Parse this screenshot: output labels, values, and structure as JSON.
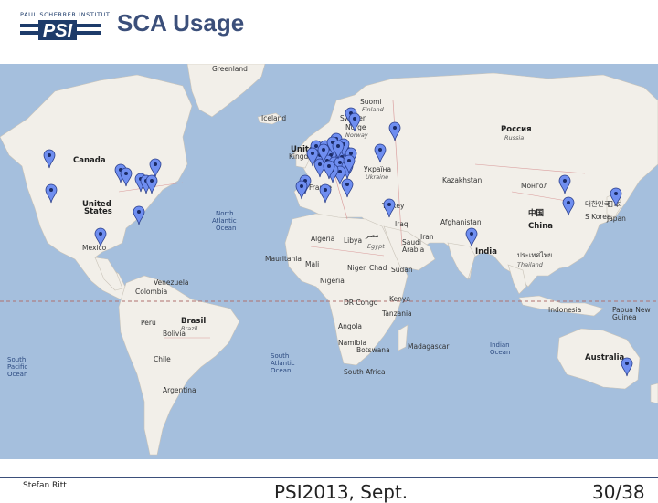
{
  "slide": {
    "title": "SCA Usage",
    "logo_text": "PAUL SCHERRER INSTITUT",
    "logo_mark": "PSI",
    "author": "Stefan Ritt",
    "conference": "PSI2013, Sept.",
    "page": "30/38"
  },
  "colors": {
    "title": "#3b4f7a",
    "ocean": "#a5bfdd",
    "land": "#f2efe9",
    "marker": "#6f8ef0",
    "rule": "#6f84a6"
  },
  "map": {
    "labels": [
      {
        "text": "Greenland",
        "cls": "ml"
      },
      {
        "text": "Iceland",
        "cls": "ml"
      },
      {
        "text": "Sweden",
        "cls": "ml"
      },
      {
        "text": "Suomi",
        "cls": "ml"
      },
      {
        "text": "Finland",
        "cls": "mls"
      },
      {
        "text": "Norge",
        "cls": "ml"
      },
      {
        "text": "Norway",
        "cls": "mls"
      },
      {
        "text": "Россия",
        "cls": "mlb"
      },
      {
        "text": "Russia",
        "cls": "mls"
      },
      {
        "text": "Canada",
        "cls": "mlb"
      },
      {
        "text": "United",
        "cls": "mlb"
      },
      {
        "text": "Kingdom",
        "cls": "ml"
      },
      {
        "text": "France",
        "cls": "ml"
      },
      {
        "text": "Україна",
        "cls": "ml"
      },
      {
        "text": "Ukraine",
        "cls": "mls"
      },
      {
        "text": "Kazakhstan",
        "cls": "ml"
      },
      {
        "text": "Монгол",
        "cls": "ml"
      },
      {
        "text": "United",
        "cls": "mlb"
      },
      {
        "text": "States",
        "cls": "mlb"
      },
      {
        "text": "North",
        "cls": "ocean"
      },
      {
        "text": "Atlantic",
        "cls": "ocean"
      },
      {
        "text": "Ocean",
        "cls": "ocean"
      },
      {
        "text": "Turkey",
        "cls": "ml"
      },
      {
        "text": "Iraq",
        "cls": "ml"
      },
      {
        "text": "Afghanistan",
        "cls": "ml"
      },
      {
        "text": "Iran",
        "cls": "ml"
      },
      {
        "text": "中国",
        "cls": "mlb"
      },
      {
        "text": "China",
        "cls": "mlb"
      },
      {
        "text": "대한민국",
        "cls": "ml"
      },
      {
        "text": "S Korea",
        "cls": "ml"
      },
      {
        "text": "日本",
        "cls": "ml"
      },
      {
        "text": "Japan",
        "cls": "ml"
      },
      {
        "text": "Mexico",
        "cls": "ml"
      },
      {
        "text": "Algeria",
        "cls": "ml"
      },
      {
        "text": "Libya",
        "cls": "ml"
      },
      {
        "text": "مصر",
        "cls": "ml"
      },
      {
        "text": "Egypt",
        "cls": "mls"
      },
      {
        "text": "Saudi",
        "cls": "ml"
      },
      {
        "text": "Arabia",
        "cls": "ml"
      },
      {
        "text": "India",
        "cls": "mlb"
      },
      {
        "text": "ประเทศไทย",
        "cls": "ml"
      },
      {
        "text": "Thailand",
        "cls": "mls"
      },
      {
        "text": "Mauritania",
        "cls": "ml"
      },
      {
        "text": "Mali",
        "cls": "ml"
      },
      {
        "text": "Niger",
        "cls": "ml"
      },
      {
        "text": "Chad",
        "cls": "ml"
      },
      {
        "text": "Sudan",
        "cls": "ml"
      },
      {
        "text": "Nigeria",
        "cls": "ml"
      },
      {
        "text": "Venezuela",
        "cls": "ml"
      },
      {
        "text": "Colombia",
        "cls": "ml"
      },
      {
        "text": "DR Congo",
        "cls": "ml"
      },
      {
        "text": "Kenya",
        "cls": "ml"
      },
      {
        "text": "Tanzania",
        "cls": "ml"
      },
      {
        "text": "Indonesia",
        "cls": "ml"
      },
      {
        "text": "Papua New",
        "cls": "ml"
      },
      {
        "text": "Guinea",
        "cls": "ml"
      },
      {
        "text": "Brasil",
        "cls": "mlb"
      },
      {
        "text": "Brazil",
        "cls": "mls"
      },
      {
        "text": "Peru",
        "cls": "ml"
      },
      {
        "text": "Bolivia",
        "cls": "ml"
      },
      {
        "text": "Angola",
        "cls": "ml"
      },
      {
        "text": "Namibia",
        "cls": "ml"
      },
      {
        "text": "Botswana",
        "cls": "ml"
      },
      {
        "text": "Madagascar",
        "cls": "ml"
      },
      {
        "text": "South Africa",
        "cls": "ml"
      },
      {
        "text": "Indian",
        "cls": "ocean"
      },
      {
        "text": "Ocean",
        "cls": "ocean"
      },
      {
        "text": "Australia",
        "cls": "mlb"
      },
      {
        "text": "South",
        "cls": "ocean"
      },
      {
        "text": "Pacific",
        "cls": "ocean"
      },
      {
        "text": "Ocean",
        "cls": "ocean"
      },
      {
        "text": "Chile",
        "cls": "ml"
      },
      {
        "text": "South",
        "cls": "ocean"
      },
      {
        "text": "Atlantic",
        "cls": "ocean"
      },
      {
        "text": "Ocean",
        "cls": "ocean"
      },
      {
        "text": "Argentina",
        "cls": "ml"
      }
    ],
    "marker_count": 48
  }
}
